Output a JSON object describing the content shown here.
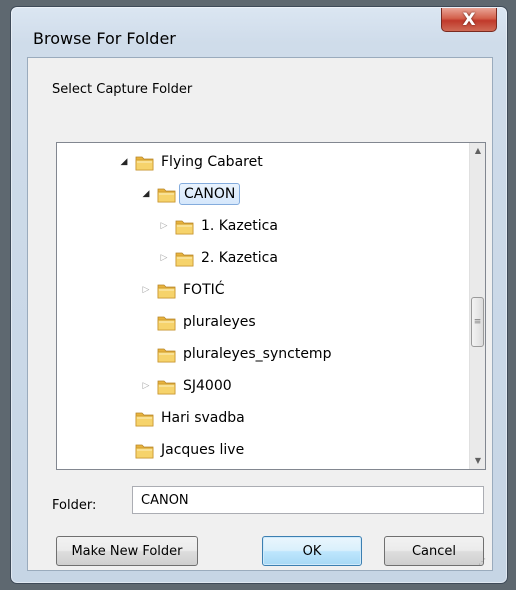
{
  "window": {
    "title": "Browse For Folder",
    "close_glyph": "X"
  },
  "prompt": "Select Capture Folder",
  "tree": {
    "items": [
      {
        "label": "Flying Cabaret",
        "expander": "expanded",
        "selected": false
      },
      {
        "label": "CANON",
        "expander": "expanded",
        "selected": true
      },
      {
        "label": "1. Kazetica",
        "expander": "collapsed",
        "selected": false
      },
      {
        "label": "2. Kazetica",
        "expander": "collapsed",
        "selected": false
      },
      {
        "label": "FOTIĆ",
        "expander": "collapsed",
        "selected": false
      },
      {
        "label": "pluraleyes",
        "expander": "none",
        "selected": false
      },
      {
        "label": "pluraleyes_synctemp",
        "expander": "none",
        "selected": false
      },
      {
        "label": "SJ4000",
        "expander": "collapsed",
        "selected": false
      },
      {
        "label": "Hari svadba",
        "expander": "none",
        "selected": false
      },
      {
        "label": "Jacques live",
        "expander": "none",
        "selected": false
      }
    ],
    "icons": {
      "folder": "folder-icon",
      "expanded": "expanded-triangle-icon",
      "collapsed": "collapsed-triangle-icon"
    }
  },
  "folder_field": {
    "label": "Folder:",
    "value": "CANON"
  },
  "buttons": {
    "new_folder": "Make New Folder",
    "ok": "OK",
    "cancel": "Cancel"
  },
  "colors": {
    "selection_border": "#84acdd",
    "close_button": "#c0392b",
    "default_button_border": "#3c7fb1"
  }
}
